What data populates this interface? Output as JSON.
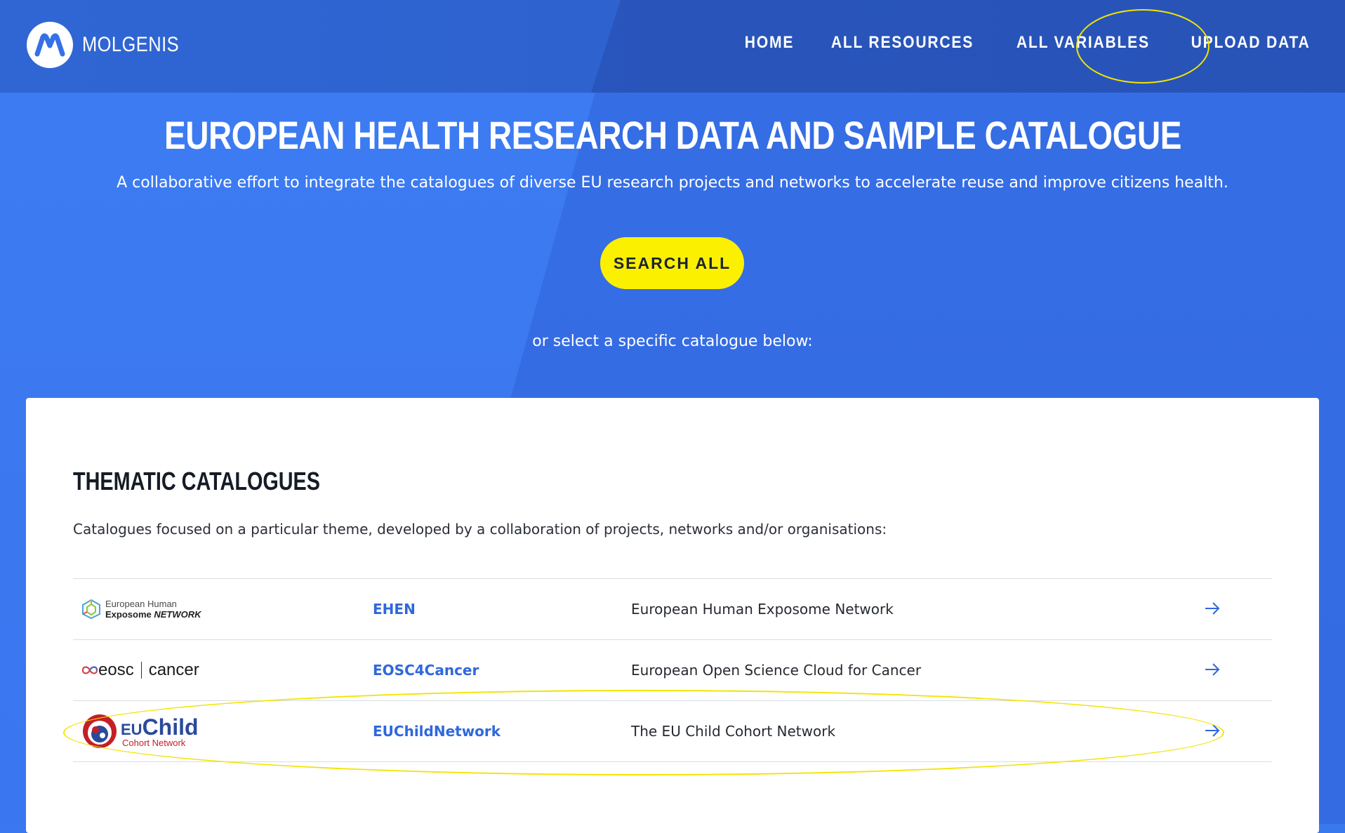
{
  "header": {
    "logo_text": "MOLGENIS",
    "nav": [
      "HOME",
      "ALL RESOURCES",
      "ALL VARIABLES",
      "UPLOAD DATA"
    ]
  },
  "hero": {
    "title": "EUROPEAN HEALTH RESEARCH DATA AND SAMPLE CATALOGUE",
    "subtitle": "A collaborative effort to integrate the catalogues of diverse EU research projects and networks to accelerate reuse and improve citizens health.",
    "search_label": "SEARCH ALL",
    "select_text": "or select a specific catalogue below:"
  },
  "card": {
    "title": "THEMATIC CATALOGUES",
    "description": "Catalogues focused on a particular theme, developed by a collaboration of projects, networks and/or organisations:",
    "rows": [
      {
        "logo": {
          "line1": "European Human",
          "line2a": "Exposome ",
          "line2b": "NETWORK"
        },
        "code": "EHEN",
        "name": "European Human Exposome Network",
        "arrow_icon": "arrow-right-icon"
      },
      {
        "logo": {
          "left": "eosc",
          "right": "cancer"
        },
        "code": "EOSC4Cancer",
        "name": "European Open Science Cloud for Cancer",
        "arrow_icon": "arrow-right-icon"
      },
      {
        "logo": {
          "eu": "EU",
          "child": "Child",
          "sub": "Cohort Network"
        },
        "code": "EUChildNetwork",
        "name": "The EU Child Cohort Network",
        "arrow_icon": "arrow-right-icon"
      }
    ]
  },
  "colors": {
    "accent": "#2f68dc",
    "button": "#fbf000",
    "highlight": "#f2e400"
  }
}
